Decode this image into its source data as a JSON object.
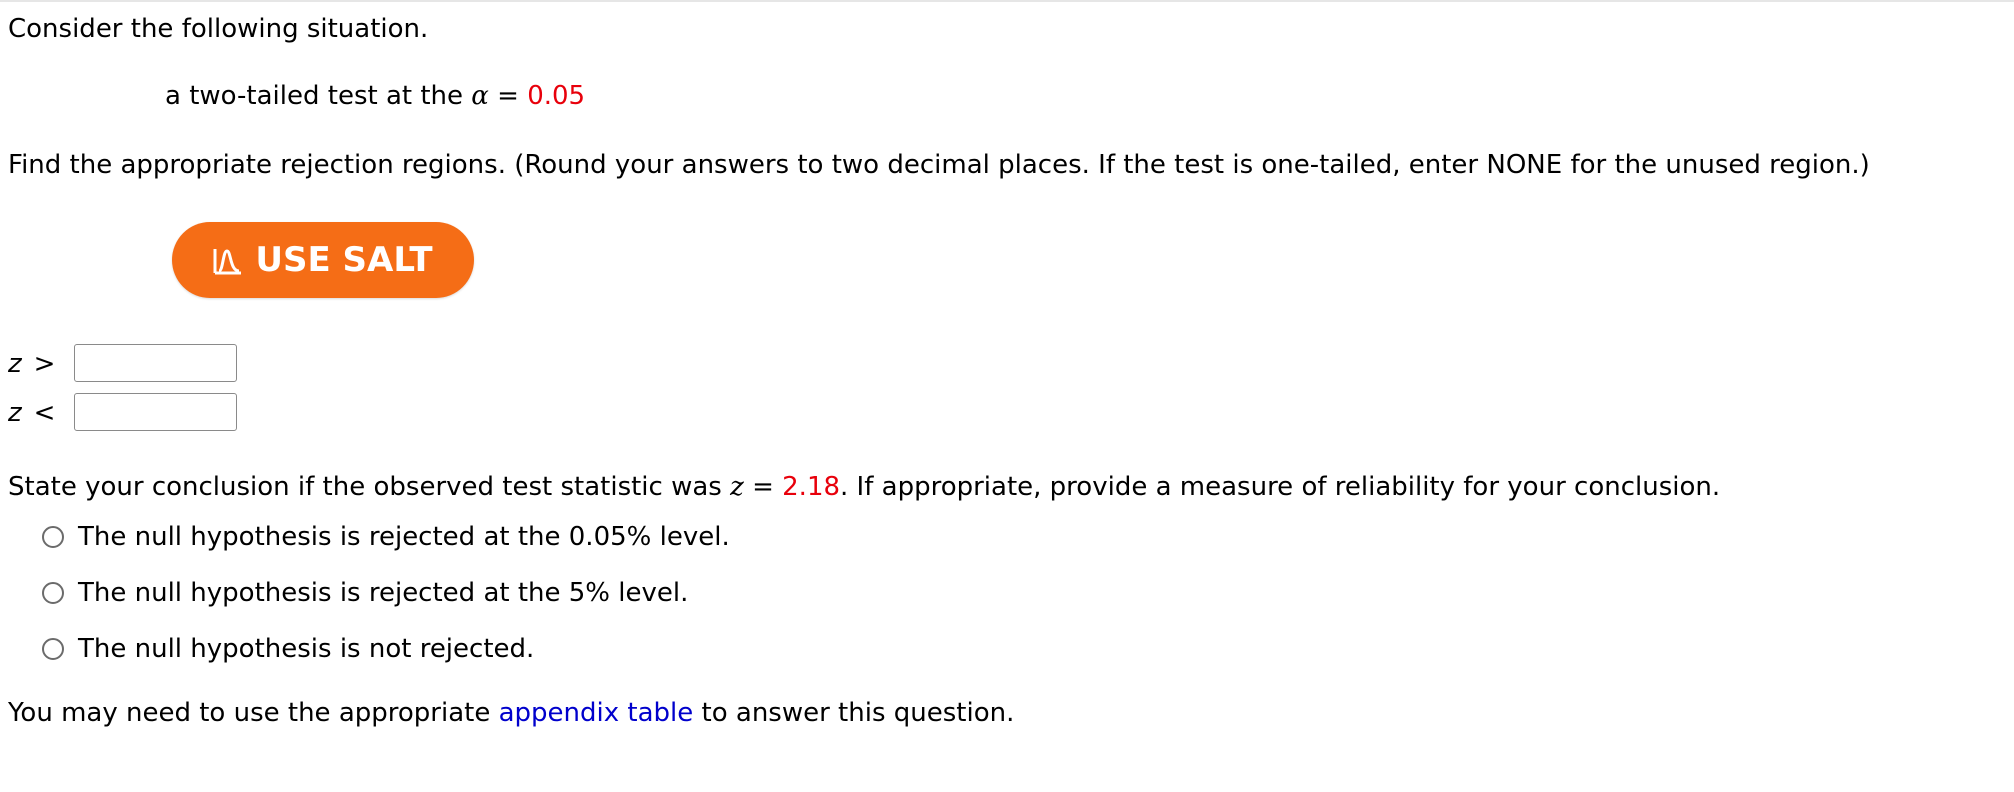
{
  "intro": {
    "text": "Consider the following situation."
  },
  "situation": {
    "prefix": "a two-tailed test at the ",
    "alpha_symbol": "α",
    "equals": " = ",
    "alpha_value": "0.05"
  },
  "instructions": {
    "text": "Find the appropriate rejection regions. (Round your answers to two decimal places. If the test is one-tailed, enter NONE for the unused region.)"
  },
  "salt_button": {
    "label": "USE SALT",
    "icon": "salt-distribution-icon",
    "color": "#f56d16"
  },
  "rejection_regions": [
    {
      "variable": "z",
      "operator": ">",
      "value": ""
    },
    {
      "variable": "z",
      "operator": "<",
      "value": ""
    }
  ],
  "conclusion_prompt": {
    "prefix": "State your conclusion if the observed test statistic was ",
    "variable": "z",
    "equals": " = ",
    "value": "2.18",
    "suffix": ". If appropriate, provide a measure of reliability for your conclusion."
  },
  "options": [
    {
      "label": "The null hypothesis is rejected at the 0.05% level."
    },
    {
      "label": "The null hypothesis is rejected at the 5% level."
    },
    {
      "label": "The null hypothesis is not rejected."
    }
  ],
  "footer": {
    "prefix": "You may need to use the appropriate ",
    "link_text": "appendix table",
    "suffix": " to answer this question."
  },
  "colors": {
    "highlight": "#e8000b",
    "link": "#0000cc"
  }
}
